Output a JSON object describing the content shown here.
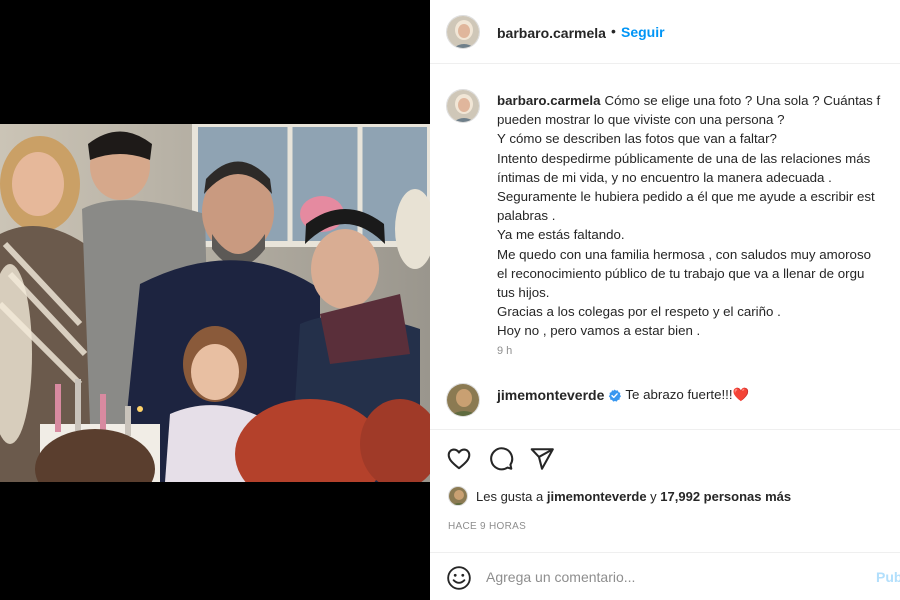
{
  "post": {
    "username": "barbaro.carmela",
    "follow_label": "Seguir",
    "header_separator": "•"
  },
  "caption": {
    "username": "barbaro.carmela",
    "lines": [
      "Cómo se elige una foto ? Una sola ? Cuántas f",
      "pueden mostrar lo que viviste con una persona ?",
      "Y cómo se describen las fotos que van a faltar?",
      "Intento despedirme públicamente de una de las relaciones más",
      "íntimas de mi vida, y no encuentro la manera adecuada .",
      "Seguramente le hubiera pedido a él que me ayude a escribir est",
      "palabras .",
      "Ya me estás faltando.",
      "Me quedo con una familia hermosa , con saludos muy amoroso",
      "el reconocimiento público de tu trabajo que va a llenar de orgu",
      "tus hijos.",
      "Gracias a los colegas por el respeto y el cariño .",
      "Hoy no , pero vamos a estar bien ."
    ],
    "time": "9 h"
  },
  "comment": {
    "username": "jimemonteverde",
    "text": "Te abrazo fuerte!!!❤️"
  },
  "likes": {
    "prefix": "Les gusta a",
    "user": "jimemonteverde",
    "joiner": "y",
    "others": "17,992 personas más"
  },
  "post_time": "HACE 9 HORAS",
  "add_comment": {
    "placeholder": "Agrega un comentario...",
    "publish_label": "Pub"
  },
  "icons": {
    "like": "heart-icon",
    "comment": "comment-bubble-icon",
    "share": "share-plane-icon",
    "emoji": "emoji-smile-icon",
    "verified": "verified-badge-icon"
  },
  "colors": {
    "accent": "#0095f6",
    "verified": "#3897f0",
    "heart": "#ed4956",
    "muted": "#8e8e8e",
    "text": "#262626"
  }
}
